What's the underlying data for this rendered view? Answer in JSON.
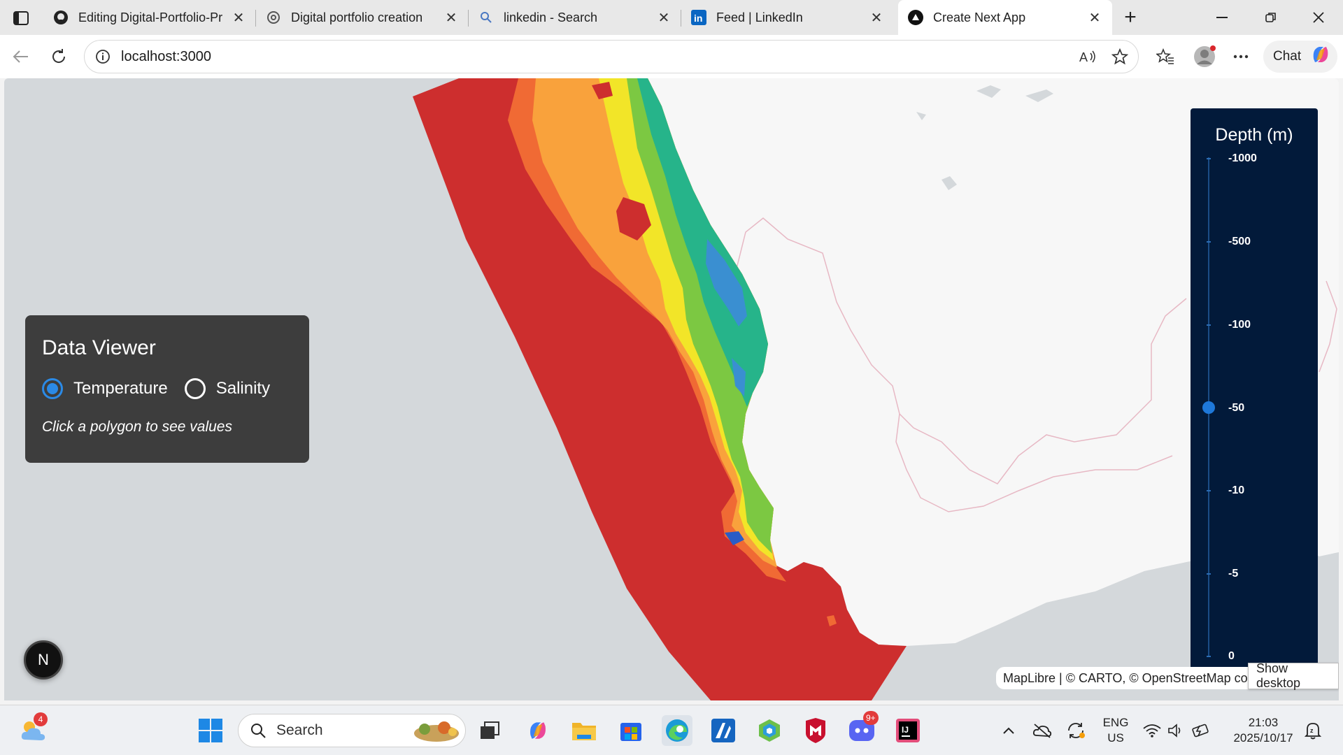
{
  "browser": {
    "tabs": [
      {
        "title": "Editing Digital-Portfolio-Pr",
        "icon": "github-icon"
      },
      {
        "title": "Digital portfolio creation",
        "icon": "chatgpt-icon"
      },
      {
        "title": "linkedin - Search",
        "icon": "search-icon"
      },
      {
        "title": "Feed | LinkedIn",
        "icon": "linkedin-icon"
      },
      {
        "title": "Create Next App",
        "icon": "nextjs-icon",
        "active": true
      }
    ],
    "url": "localhost:3000",
    "chat_label": "Chat"
  },
  "data_viewer": {
    "title": "Data Viewer",
    "options": [
      "Temperature",
      "Salinity"
    ],
    "selected": "Temperature",
    "hint": "Click a polygon to see values"
  },
  "depth_legend": {
    "title": "Depth (m)",
    "levels": [
      "-1000",
      "-500",
      "-100",
      "-50",
      "-10",
      "-5",
      "0"
    ],
    "selected": "-50"
  },
  "map": {
    "attribution": "MapLibre | © CARTO, © OpenStreetMap contributors",
    "show_desktop": "Show desktop",
    "next_badge": "N",
    "colors": {
      "ocean": "#d4d8db",
      "land": "#f7f7f7",
      "hot": "#cd2e2e",
      "border": "#e7b8c4"
    }
  },
  "taskbar": {
    "search_placeholder": "Search",
    "weather_badge": "4",
    "discord_badge": "9+",
    "lang": "ENG",
    "region": "US",
    "time": "21:03",
    "date": "2025/10/17"
  }
}
